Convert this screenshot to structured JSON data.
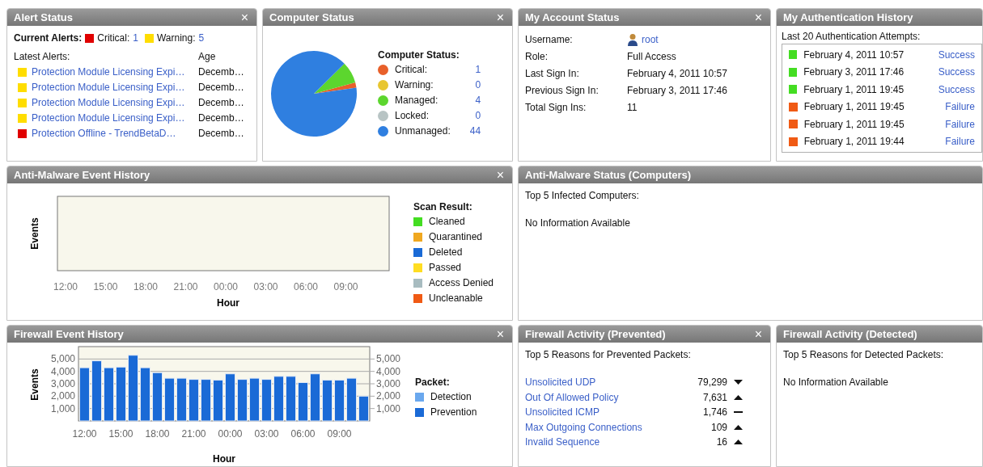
{
  "widgets": [
    {
      "kind": "alerts",
      "title": "Alert Status",
      "close": "×",
      "heading": "Current Alerts:",
      "summary": [
        {
          "label": "Critical:",
          "count": "1",
          "color": "#e00000"
        },
        {
          "label": "Warning:",
          "count": "5",
          "color": "#ffdd00"
        }
      ],
      "columns": [
        "Latest Alerts:",
        "Age"
      ],
      "rows": [
        {
          "color": "#ffdd00",
          "name": "Protection Module Licensing Expi…",
          "age": "Decemb…"
        },
        {
          "color": "#ffdd00",
          "name": "Protection Module Licensing Expi…",
          "age": "Decemb…"
        },
        {
          "color": "#ffdd00",
          "name": "Protection Module Licensing Expi…",
          "age": "Decemb…"
        },
        {
          "color": "#ffdd00",
          "name": "Protection Module Licensing Expi…",
          "age": "Decemb…"
        },
        {
          "color": "#e00000",
          "name": "Protection Offline - TrendBetaD…",
          "age": "Decemb…"
        }
      ]
    },
    {
      "kind": "computers",
      "title": "Computer Status",
      "close": "×",
      "legend_title": "Computer Status:",
      "legend": [
        {
          "label": "Critical:",
          "color": "#e8602a",
          "count": "1"
        },
        {
          "label": "Warning:",
          "color": "#e8c630",
          "count": "0"
        },
        {
          "label": "Managed:",
          "color": "#5cd62e",
          "count": "4"
        },
        {
          "label": "Locked:",
          "color": "#b8c4c4",
          "count": "0"
        },
        {
          "label": "Unmanaged:",
          "color": "#2f7fe0",
          "count": "44"
        }
      ]
    },
    {
      "kind": "account",
      "title": "My Account Status",
      "close": "×",
      "fields": [
        {
          "kind": "user",
          "label": "Username:",
          "value": "root"
        },
        {
          "kind": "text",
          "label": "Role:",
          "value": "Full Access"
        },
        {
          "kind": "text",
          "label": "Last Sign In:",
          "value": "February 4, 2011 10:57"
        },
        {
          "kind": "text",
          "label": "Previous Sign In:",
          "value": "February 3, 2011 17:46"
        },
        {
          "kind": "text",
          "label": "Total Sign Ins:",
          "value": "11"
        }
      ]
    },
    {
      "kind": "auth",
      "title": "My Authentication History",
      "caption": "Last 20 Authentication Attempts:",
      "rows": [
        {
          "color": "#44dd22",
          "time": "February 4, 2011 10:57",
          "result": "Success"
        },
        {
          "color": "#44dd22",
          "time": "February 3, 2011 17:46",
          "result": "Success"
        },
        {
          "color": "#44dd22",
          "time": "February 1, 2011 19:45",
          "result": "Success"
        },
        {
          "color": "#f05a14",
          "time": "February 1, 2011 19:45",
          "result": "Failure"
        },
        {
          "color": "#f05a14",
          "time": "February 1, 2011 19:45",
          "result": "Failure"
        },
        {
          "color": "#f05a14",
          "time": "February 1, 2011 19:44",
          "result": "Failure"
        }
      ]
    },
    {
      "kind": "emptychart",
      "title": "Anti-Malware Event History",
      "close": "×",
      "ylabel": "Events",
      "xlabel": "Hour",
      "xticks": [
        "12:00",
        "15:00",
        "18:00",
        "21:00",
        "00:00",
        "03:00",
        "06:00",
        "09:00"
      ],
      "legend_title": "Scan Result:",
      "legend": [
        {
          "label": "Cleaned",
          "color": "#44dd22"
        },
        {
          "label": "Quarantined",
          "color": "#f0a820"
        },
        {
          "label": "Deleted",
          "color": "#1a6ad6"
        },
        {
          "label": "Passed",
          "color": "#ffdd22"
        },
        {
          "label": "Access Denied",
          "color": "#a8bcc0"
        },
        {
          "label": "Uncleanable",
          "color": "#f05a14"
        }
      ]
    },
    {
      "kind": "text",
      "title": "Anti-Malware Status (Computers)",
      "caption": "Top 5 Infected Computers:",
      "message": "No Information Available"
    },
    {
      "kind": "barchart",
      "title": "Firewall Event History",
      "close": "×",
      "legend_title": "Packet:",
      "chart_data": {
        "type": "bar",
        "xlabel": "Hour",
        "ylabel": "Events",
        "grid": true,
        "categories": [
          "12:00",
          null,
          null,
          "15:00",
          null,
          null,
          "18:00",
          null,
          null,
          "21:00",
          null,
          null,
          "00:00",
          null,
          null,
          "03:00",
          null,
          null,
          "06:00",
          null,
          null,
          "09:00",
          null,
          null
        ],
        "series": [
          {
            "name": "Detection",
            "color": "#6aa8ee",
            "values": [
              null,
              null,
              null,
              null,
              null,
              null,
              null,
              null,
              null,
              null,
              null,
              null,
              null,
              null,
              null,
              null,
              null,
              null,
              null,
              null,
              null,
              null,
              null,
              null
            ]
          },
          {
            "name": "Prevention",
            "color": "#1a6ad6",
            "values": [
              4300,
              4850,
              4300,
              4350,
              5300,
              4300,
              3900,
              3450,
              3450,
              3350,
              3350,
              3300,
              3800,
              3350,
              3450,
              3350,
              3600,
              3600,
              3100,
              3800,
              3300,
              3300,
              3450,
              2000
            ]
          }
        ],
        "yticks": [
          {
            "value": 1000,
            "label": "1,000"
          },
          {
            "value": 2000,
            "label": "2,000"
          },
          {
            "value": 3000,
            "label": "3,000"
          },
          {
            "value": 4000,
            "label": "4,000"
          },
          {
            "value": 5000,
            "label": "5,000"
          }
        ],
        "ylim": [
          0,
          6000
        ]
      }
    },
    {
      "kind": "reasons",
      "title": "Firewall Activity (Prevented)",
      "close": "×",
      "caption": "Top 5 Reasons for Prevented Packets:",
      "rows": [
        {
          "name": "Unsolicited UDP",
          "count": "79,299",
          "kind": "down"
        },
        {
          "name": "Out Of Allowed Policy",
          "count": "7,631",
          "kind": "up"
        },
        {
          "name": "Unsolicited ICMP",
          "count": "1,746",
          "kind": "flat"
        },
        {
          "name": "Max Outgoing Connections",
          "count": "109",
          "kind": "up"
        },
        {
          "name": "Invalid Sequence",
          "count": "16",
          "kind": "up"
        }
      ]
    },
    {
      "kind": "text",
      "title": "Firewall Activity (Detected)",
      "caption": "Top 5 Reasons for Detected Packets:",
      "message": "No Information Available"
    }
  ]
}
